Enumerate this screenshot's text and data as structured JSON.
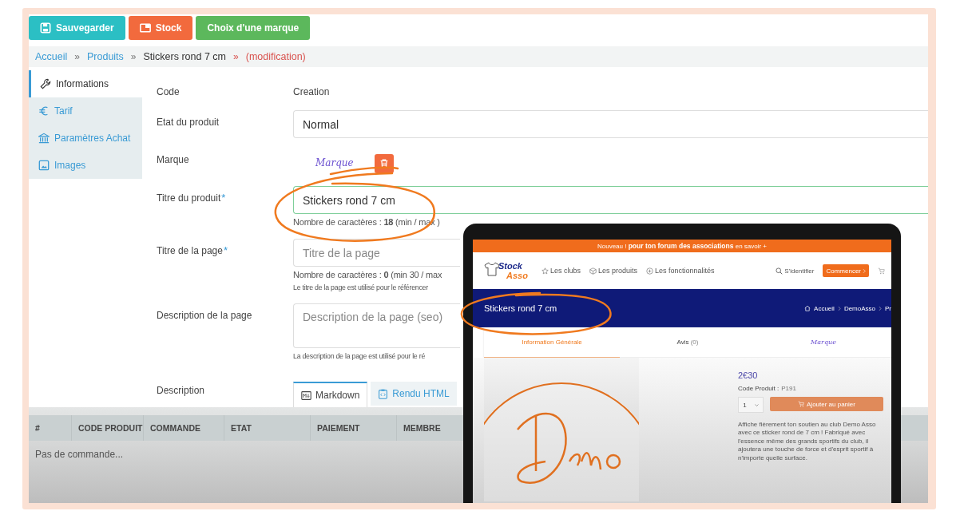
{
  "toolbar": [
    {
      "label": "Sauvegarder",
      "kind": "save"
    },
    {
      "label": "Stock",
      "kind": "stock"
    },
    {
      "label": "Choix d'une marque",
      "kind": "brand"
    }
  ],
  "breadcrumb": [
    {
      "label": "Accueil",
      "kind": "link"
    },
    {
      "prefix": "»",
      "label": "Produits",
      "kind": "link"
    },
    {
      "prefix": "»",
      "label": "Stickers rond 7 cm",
      "kind": "current"
    },
    {
      "prefix": "»",
      "label": "(modification)",
      "kind": "status"
    }
  ],
  "sidebar": {
    "items": [
      {
        "label": "Informations",
        "selected": true
      },
      {
        "label": "Tarif",
        "selected": false
      },
      {
        "label": "Paramètres Achat",
        "selected": false
      },
      {
        "label": "Images",
        "selected": false
      }
    ]
  },
  "form": {
    "fields": [
      {
        "kind": "static",
        "label": "Code",
        "value": "Creation"
      },
      {
        "kind": "select",
        "label": "Etat du produit",
        "value": "Normal"
      },
      {
        "kind": "brand",
        "label": "Marque",
        "logo": "Marque"
      },
      {
        "kind": "text",
        "label": "Titre du produit",
        "required_mark": "*",
        "value": "Stickers rond 7 cm",
        "focused": true,
        "help": [
          {
            "kind": "count",
            "text": "Nombre de caractères : **18** (min / max )"
          }
        ]
      },
      {
        "kind": "text",
        "label": "Titre de la page",
        "required_mark": "*",
        "placeholder": "Titre de la page",
        "focused": false,
        "help": [
          {
            "kind": "count",
            "text": "Nombre de caractères : **0** (min 30 / max"
          },
          {
            "kind": "note",
            "text": "Le titre de la page est utilisé pour le référencer"
          }
        ]
      },
      {
        "kind": "textarea",
        "label": "Description de la page",
        "placeholder": "Description de la page (seo)",
        "help": [
          {
            "kind": "note",
            "text": "La description de la page est utilisé pour le ré"
          }
        ]
      },
      {
        "kind": "editor",
        "label": "Description",
        "tabs": [
          {
            "label": "Markdown",
            "selected": true
          },
          {
            "label": "Rendu HTML",
            "selected": false
          }
        ]
      }
    ]
  },
  "orders_table": {
    "columns": [
      "#",
      "CODE PRODUIT",
      "COMMANDE",
      "ETAT",
      "PAIEMENT",
      "MEMBRE"
    ],
    "empty_message": "Pas de commande..."
  },
  "preview": {
    "banner": "Nouveau ! **pour ton forum des associations** en savoir +",
    "logo": [
      "Stock",
      "Asso"
    ],
    "nav": [
      {
        "label": "Les clubs"
      },
      {
        "label": "Les produits"
      },
      {
        "label": "Les fonctionnalités"
      }
    ],
    "login": "S'identifier",
    "cta": "Commencer",
    "title": "Stickers rond 7 cm",
    "breadcrumb": [
      "Accueil",
      "DemoAsso",
      "Pr"
    ],
    "tabs": [
      {
        "kind": "text",
        "label": "Information Générale",
        "selected": true
      },
      {
        "kind": "text",
        "label": "Avis",
        "count": "(0)",
        "selected": false
      },
      {
        "kind": "logo",
        "label": "Marque",
        "selected": false
      }
    ],
    "price": "2€30",
    "code_label": "Code Produit :",
    "code": "P191",
    "quantity": "1",
    "add_to_cart": "Ajouter au panier",
    "description": "Affiche fièrement ton soutien au club Demo Asso avec ce sticker rond de 7 cm ! Fabriqué avec l'essence même des grands sportifs du club, il ajoutera une touche de force et d'esprit sportif à n'importe quelle surface."
  }
}
